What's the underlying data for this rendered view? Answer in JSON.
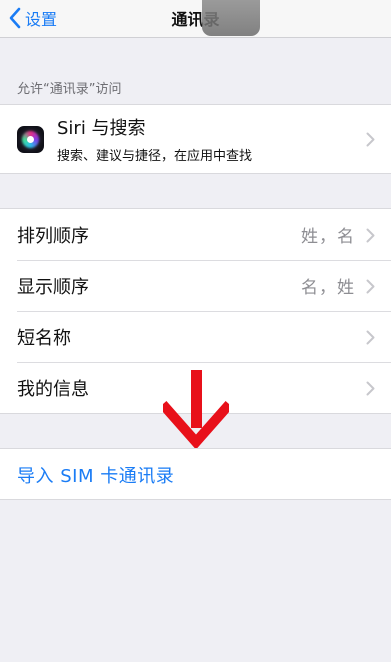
{
  "nav": {
    "back_label": "设置",
    "title": "通讯录"
  },
  "section_header": "允许“通讯录”访问",
  "siri": {
    "title": "Siri 与搜索",
    "subtitle": "搜索、建议与捷径，在应用中查找"
  },
  "settings": {
    "sort_order": {
      "label": "排列顺序",
      "value": "姓，名"
    },
    "display_order": {
      "label": "显示顺序",
      "value": "名，姓"
    },
    "short_name": {
      "label": "短名称"
    },
    "my_info": {
      "label": "我的信息"
    }
  },
  "import_sim": {
    "label": "导入 SIM 卡通讯录"
  },
  "colors": {
    "accent": "#1a7cf5",
    "annotation_arrow": "#e8101a",
    "background": "#efeff4"
  },
  "icons": [
    "chevron-left-icon",
    "siri-icon",
    "chevron-right-icon",
    "red-down-arrow-annotation"
  ]
}
